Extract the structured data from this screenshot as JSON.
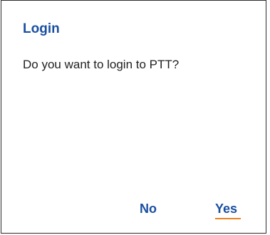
{
  "dialog": {
    "title": "Login",
    "message": "Do you want to login to PTT?",
    "no_label": "No",
    "yes_label": "Yes"
  },
  "colors": {
    "accent": "#1a4fa0",
    "focus_underline": "#e8821e",
    "text": "#1f1f1f",
    "border": "#2b2b2b",
    "background": "#ffffff"
  }
}
